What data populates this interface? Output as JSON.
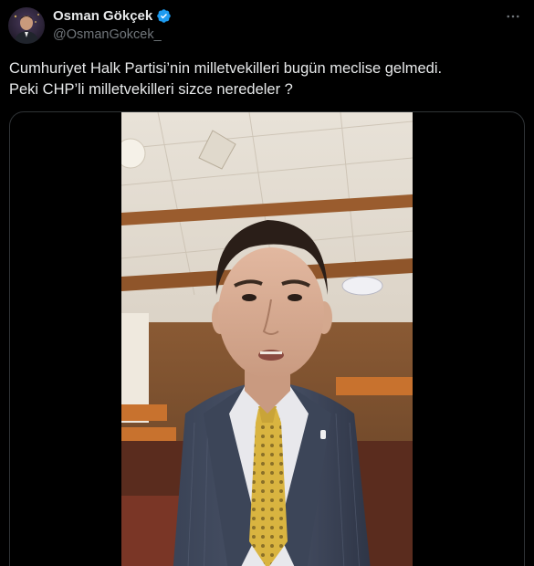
{
  "author": {
    "display_name": "Osman Gökçek",
    "handle": "@OsmanGokcek_",
    "verified": true,
    "verified_color": "#1d9bf0"
  },
  "tweet": {
    "text_lines": [
      "Cumhuriyet Halk Partisi’nin milletvekilleri bugün meclise gelmedi.",
      "Peki CHP’li milletvekilleri sizce neredeler ?"
    ]
  },
  "icons": {
    "more": "more-horizontal-icon",
    "verified": "verified-badge-icon"
  },
  "colors": {
    "background": "#000000",
    "text": "#e7e9ea",
    "secondary_text": "#71767b",
    "border": "#2f3336"
  }
}
